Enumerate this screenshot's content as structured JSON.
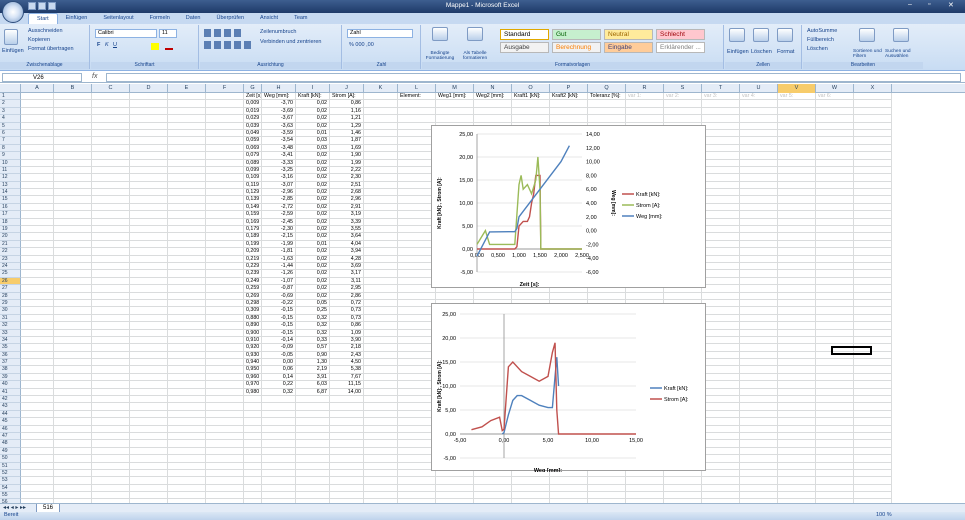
{
  "window": {
    "title": "Mappe1 - Microsoft Excel",
    "min": "–",
    "max": "▫",
    "close": "✕"
  },
  "tabs": [
    "Start",
    "Einfügen",
    "Seitenlayout",
    "Formeln",
    "Daten",
    "Überprüfen",
    "Ansicht",
    "Team"
  ],
  "ribbon": {
    "clipboard": {
      "paste": "Einfügen",
      "cut": "Ausschneiden",
      "copy": "Kopieren",
      "format_painter": "Format übertragen",
      "label": "Zwischenablage"
    },
    "font": {
      "name": "Calibri",
      "size": "11",
      "label": "Schriftart"
    },
    "alignment": {
      "wrap": "Zeilenumbruch",
      "merge": "Verbinden und zentrieren",
      "label": "Ausrichtung"
    },
    "number": {
      "format": "Zahl",
      "label": "Zahl"
    },
    "styles": {
      "conditional": "Bedingte Formatierung",
      "table": "Als Tabelle formatieren",
      "label": "Formatvorlagen",
      "items": [
        {
          "name": "Standard",
          "bg": "#ffffff",
          "fg": "#000000"
        },
        {
          "name": "Gut",
          "bg": "#c6efce",
          "fg": "#006100"
        },
        {
          "name": "Neutral",
          "bg": "#ffeb9c",
          "fg": "#9c6500"
        },
        {
          "name": "Schlecht",
          "bg": "#ffc7ce",
          "fg": "#9c0006"
        },
        {
          "name": "Ausgabe",
          "bg": "#f2f2f2",
          "fg": "#3f3f3f"
        },
        {
          "name": "Berechnung",
          "bg": "#f2f2f2",
          "fg": "#fa7d00"
        },
        {
          "name": "Eingabe",
          "bg": "#ffcc99",
          "fg": "#3f3f76"
        },
        {
          "name": "Erklärender ...",
          "bg": "#ffffff",
          "fg": "#7f7f7f"
        }
      ]
    },
    "cells": {
      "insert": "Einfügen",
      "delete": "Löschen",
      "format": "Format",
      "label": "Zellen"
    },
    "editing": {
      "autosum": "AutoSumme",
      "fill": "Füllbereich",
      "clear": "Löschen",
      "sort": "Sortieren und Filtern",
      "find": "Suchen und Auswählen",
      "label": "Bearbeiten"
    }
  },
  "formula_bar": {
    "name_box": "V26",
    "fx": "fx",
    "value": ""
  },
  "columns": [
    "A",
    "B",
    "C",
    "D",
    "E",
    "F",
    "G",
    "H",
    "I",
    "J",
    "K",
    "L",
    "M",
    "N",
    "O",
    "P",
    "Q",
    "R",
    "S",
    "T",
    "U",
    "V",
    "W",
    "X"
  ],
  "selected_column": "V",
  "selected_row": 26,
  "headers_G_J": [
    "Zeit [s]:",
    "Weg [mm]:",
    "Kraft [kN]:",
    "Strom [A]:"
  ],
  "headers_L_Q": [
    "Element:",
    "Weg1 [mm]:",
    "Weg2 [mm]:",
    "Kraft1 [kN]:",
    "Kraft2 [kN]:",
    "Toleranz [%]:"
  ],
  "headers_R_W_grey": [
    "var 1:",
    "var 2:",
    "var 3:",
    "var 4:",
    "var 5:",
    "var 6:"
  ],
  "rows": [
    [
      "0,009",
      "-3,70",
      "0,02",
      "0,86"
    ],
    [
      "0,019",
      "-3,69",
      "0,02",
      "1,16"
    ],
    [
      "0,029",
      "-3,67",
      "0,02",
      "1,21"
    ],
    [
      "0,039",
      "-3,63",
      "0,02",
      "1,29"
    ],
    [
      "0,049",
      "-3,59",
      "0,01",
      "1,46"
    ],
    [
      "0,059",
      "-3,54",
      "0,03",
      "1,87"
    ],
    [
      "0,069",
      "-3,48",
      "0,03",
      "1,69"
    ],
    [
      "0,079",
      "-3,41",
      "0,02",
      "1,90"
    ],
    [
      "0,089",
      "-3,33",
      "0,02",
      "1,99"
    ],
    [
      "0,099",
      "-3,25",
      "0,02",
      "2,22"
    ],
    [
      "0,109",
      "-3,16",
      "0,02",
      "2,30"
    ],
    [
      "0,119",
      "-3,07",
      "0,02",
      "2,51"
    ],
    [
      "0,129",
      "-2,96",
      "0,02",
      "2,68"
    ],
    [
      "0,139",
      "-2,85",
      "0,02",
      "2,96"
    ],
    [
      "0,149",
      "-2,72",
      "0,02",
      "2,91"
    ],
    [
      "0,159",
      "-2,59",
      "0,02",
      "3,19"
    ],
    [
      "0,169",
      "-2,45",
      "0,02",
      "3,39"
    ],
    [
      "0,179",
      "-2,30",
      "0,02",
      "3,55"
    ],
    [
      "0,189",
      "-2,15",
      "0,02",
      "3,64"
    ],
    [
      "0,199",
      "-1,99",
      "0,01",
      "4,04"
    ],
    [
      "0,209",
      "-1,81",
      "0,02",
      "3,94"
    ],
    [
      "0,219",
      "-1,63",
      "0,02",
      "4,28"
    ],
    [
      "0,229",
      "-1,44",
      "0,02",
      "3,69"
    ],
    [
      "0,239",
      "-1,26",
      "0,02",
      "3,17"
    ],
    [
      "0,249",
      "-1,07",
      "0,02",
      "3,11"
    ],
    [
      "0,259",
      "-0,87",
      "0,02",
      "2,95"
    ],
    [
      "0,269",
      "-0,69",
      "0,02",
      "2,86"
    ],
    [
      "0,298",
      "-0,22",
      "0,05",
      "0,72"
    ],
    [
      "0,309",
      "-0,15",
      "0,25",
      "0,73"
    ],
    [
      "0,880",
      "-0,15",
      "0,32",
      "0,73"
    ],
    [
      "0,890",
      "-0,15",
      "0,32",
      "0,86"
    ],
    [
      "0,900",
      "-0,15",
      "0,32",
      "1,09"
    ],
    [
      "0,910",
      "-0,14",
      "0,33",
      "3,90"
    ],
    [
      "0,920",
      "-0,09",
      "0,57",
      "2,18"
    ],
    [
      "0,930",
      "-0,05",
      "0,90",
      "2,43"
    ],
    [
      "0,940",
      "0,00",
      "1,30",
      "4,50"
    ],
    [
      "0,950",
      "0,06",
      "2,19",
      "5,38"
    ],
    [
      "0,960",
      "0,14",
      "3,91",
      "7,67"
    ],
    [
      "0,970",
      "0,22",
      "6,03",
      "11,15"
    ],
    [
      "0,980",
      "0,32",
      "6,87",
      "14,00"
    ]
  ],
  "sheet_tab": "516",
  "status": {
    "ready": "Bereit",
    "zoom": "100 %"
  },
  "chart_data": [
    {
      "type": "line",
      "title": "",
      "xlabel": "Zeit [s]:",
      "ylabel": "Kraft [kN]:, Strom [A]:",
      "y2label": "Weg [mm]:",
      "xlim": [
        0,
        2.5
      ],
      "ylim": [
        -5,
        25
      ],
      "y2lim": [
        -6,
        14
      ],
      "xticks": [
        "0,000",
        "0,500",
        "1,000",
        "1,500",
        "2,000",
        "2,500"
      ],
      "yticks": [
        "-5,00",
        "0,00",
        "5,00",
        "10,00",
        "15,00",
        "20,00",
        "25,00"
      ],
      "y2ticks": [
        "-6,00",
        "-4,00",
        "-2,00",
        "0,00",
        "2,00",
        "4,00",
        "6,00",
        "8,00",
        "10,00",
        "12,00",
        "14,00"
      ],
      "legend_position": "right",
      "series": [
        {
          "name": "Kraft [kN]:",
          "color": "#c0504d",
          "axis": "y",
          "x": [
            0,
            0.9,
            0.95,
            1.0,
            1.1,
            1.2,
            1.25,
            1.3,
            1.35,
            1.4,
            1.5,
            1.52,
            1.55,
            1.6,
            2.5
          ],
          "y": [
            0,
            0,
            0.5,
            5,
            6,
            6,
            7,
            10,
            12,
            16,
            16,
            0,
            0,
            0,
            0
          ]
        },
        {
          "name": "Strom [A]:",
          "color": "#9bbb59",
          "axis": "y",
          "x": [
            0,
            0.1,
            0.2,
            0.3,
            0.9,
            1.0,
            1.05,
            1.1,
            1.2,
            1.3,
            1.4,
            1.45,
            1.5,
            1.52,
            1.6,
            2.5
          ],
          "y": [
            1,
            2.5,
            4,
            1,
            1,
            14,
            16,
            13,
            14,
            12,
            15,
            20,
            13,
            0,
            0,
            0
          ]
        },
        {
          "name": "Weg [mm]:",
          "color": "#4f81bd",
          "axis": "y2",
          "x": [
            0,
            0.3,
            0.9,
            0.95,
            1.0,
            1.5,
            2.0,
            2.2
          ],
          "y": [
            -3.7,
            -0.2,
            -0.15,
            0.3,
            2,
            6,
            10,
            12.3
          ]
        }
      ]
    },
    {
      "type": "line",
      "title": "",
      "xlabel": "Weg [mm]:",
      "ylabel": "Kraft [kN]:, Strom [A]:",
      "xlim": [
        -5,
        15
      ],
      "ylim": [
        -5,
        25
      ],
      "xticks": [
        "-5,00",
        "0,00",
        "5,00",
        "10,00",
        "15,00"
      ],
      "yticks": [
        "-5,00",
        "0,00",
        "5,00",
        "10,00",
        "15,00",
        "20,00",
        "25,00"
      ],
      "legend_position": "right",
      "series": [
        {
          "name": "Kraft [kN]:",
          "color": "#4f81bd",
          "x": [
            -0.2,
            0,
            0.5,
            1,
            1.5,
            2,
            3,
            4,
            5,
            5.5,
            5.8,
            6,
            6.2
          ],
          "y": [
            0,
            0.3,
            4,
            7,
            8,
            8,
            7,
            6,
            5.5,
            5.5,
            12,
            16,
            10
          ]
        },
        {
          "name": "Strom [A]:",
          "color": "#c0504d",
          "x": [
            -3.7,
            -2.5,
            -1.5,
            -0.5,
            -0.2,
            0,
            0.5,
            1,
            2,
            3,
            4,
            5,
            5.5,
            5.8,
            6,
            6.2,
            6.5,
            15
          ],
          "y": [
            0.9,
            1.5,
            2.8,
            3.5,
            0.7,
            1,
            14,
            15,
            13,
            12,
            11,
            12,
            17,
            19,
            5,
            0,
            0,
            0
          ]
        }
      ]
    }
  ]
}
